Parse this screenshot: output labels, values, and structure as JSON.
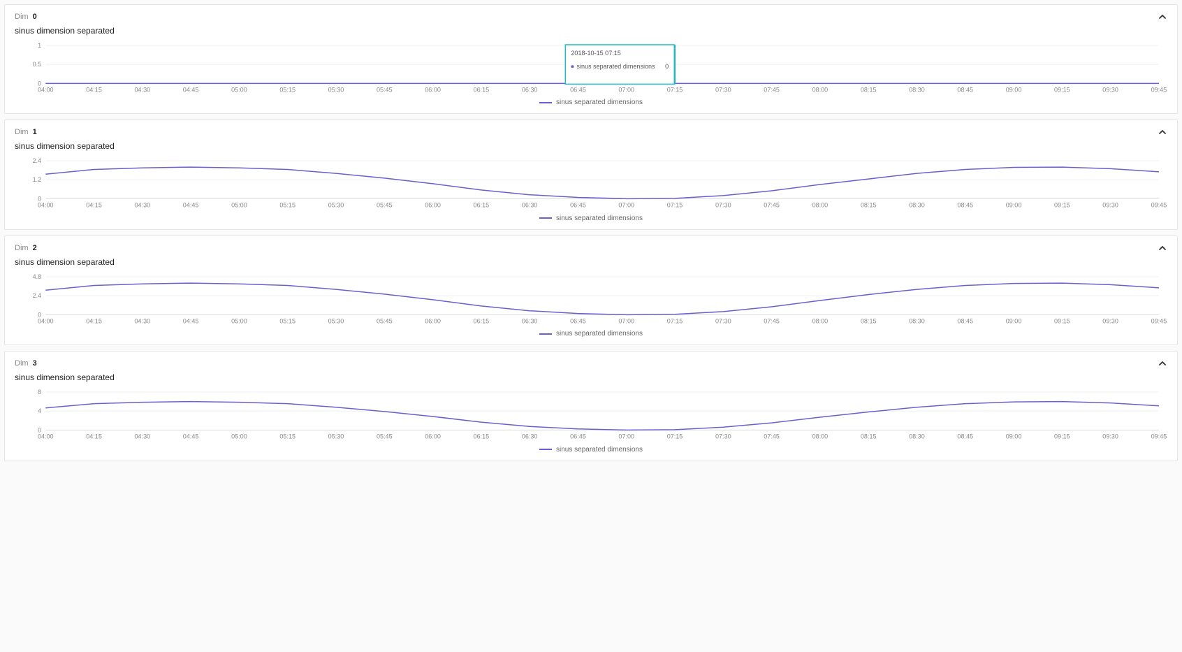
{
  "dim_label_prefix": "Dim",
  "panels": [
    {
      "dim": "0",
      "title": "sinus dimension separated",
      "chart_idx": 0
    },
    {
      "dim": "1",
      "title": "sinus dimension separated",
      "chart_idx": 1
    },
    {
      "dim": "2",
      "title": "sinus dimension separated",
      "chart_idx": 2
    },
    {
      "dim": "3",
      "title": "sinus dimension separated",
      "chart_idx": 3
    }
  ],
  "legend_label": "sinus separated dimensions",
  "x_ticks": [
    "04:00",
    "04:15",
    "04:30",
    "04:45",
    "05:00",
    "05:15",
    "05:30",
    "05:45",
    "06:00",
    "06:15",
    "06:30",
    "06:45",
    "07:00",
    "07:15",
    "07:30",
    "07:45",
    "08:00",
    "08:15",
    "08:30",
    "08:45",
    "09:00",
    "09:15",
    "09:30",
    "09:45"
  ],
  "tooltip": {
    "panel_idx": 0,
    "timestamp_label": "2018-10-15 07:15",
    "series_label": "sinus separated dimensions",
    "value": "0",
    "cursor_x_tick": "07:15",
    "box_x_tick": "06:45"
  },
  "chart_data": [
    {
      "type": "line",
      "title": "sinus dimension separated",
      "xlabel": "",
      "ylabel": "",
      "ylim": [
        0,
        1
      ],
      "y_ticks": [
        0,
        0.5,
        1
      ],
      "x": [
        "04:00",
        "04:15",
        "04:30",
        "04:45",
        "05:00",
        "05:15",
        "05:30",
        "05:45",
        "06:00",
        "06:15",
        "06:30",
        "06:45",
        "07:00",
        "07:15",
        "07:30",
        "07:45",
        "08:00",
        "08:15",
        "08:30",
        "08:45",
        "09:00",
        "09:15",
        "09:30",
        "09:45"
      ],
      "series": [
        {
          "name": "sinus separated dimensions",
          "values": [
            0,
            0,
            0,
            0,
            0,
            0,
            0,
            0,
            0,
            0,
            0,
            0,
            0,
            0,
            0,
            0,
            0,
            0,
            0,
            0,
            0,
            0,
            0,
            0
          ]
        }
      ]
    },
    {
      "type": "line",
      "title": "sinus dimension separated",
      "xlabel": "",
      "ylabel": "",
      "ylim": [
        0,
        2.4
      ],
      "y_ticks": [
        0,
        1.2,
        2.4
      ],
      "x": [
        "04:00",
        "04:15",
        "04:30",
        "04:45",
        "05:00",
        "05:15",
        "05:30",
        "05:45",
        "06:00",
        "06:15",
        "06:30",
        "06:45",
        "07:00",
        "07:15",
        "07:30",
        "07:45",
        "08:00",
        "08:15",
        "08:30",
        "08:45",
        "09:00",
        "09:15",
        "09:30",
        "09:45"
      ],
      "series": [
        {
          "name": "sinus separated dimensions",
          "values": [
            1.55,
            1.85,
            1.95,
            2.0,
            1.95,
            1.85,
            1.6,
            1.3,
            0.95,
            0.55,
            0.25,
            0.08,
            0.0,
            0.02,
            0.2,
            0.5,
            0.9,
            1.25,
            1.6,
            1.85,
            1.98,
            2.0,
            1.9,
            1.7
          ]
        }
      ]
    },
    {
      "type": "line",
      "title": "sinus dimension separated",
      "xlabel": "",
      "ylabel": "",
      "ylim": [
        0,
        4.8
      ],
      "y_ticks": [
        0,
        2.4,
        4.8
      ],
      "x": [
        "04:00",
        "04:15",
        "04:30",
        "04:45",
        "05:00",
        "05:15",
        "05:30",
        "05:45",
        "06:00",
        "06:15",
        "06:30",
        "06:45",
        "07:00",
        "07:15",
        "07:30",
        "07:45",
        "08:00",
        "08:15",
        "08:30",
        "08:45",
        "09:00",
        "09:15",
        "09:30",
        "09:45"
      ],
      "series": [
        {
          "name": "sinus separated dimensions",
          "values": [
            3.1,
            3.7,
            3.9,
            4.0,
            3.9,
            3.7,
            3.2,
            2.6,
            1.9,
            1.1,
            0.5,
            0.15,
            0.0,
            0.05,
            0.4,
            1.0,
            1.8,
            2.55,
            3.2,
            3.7,
            3.95,
            4.0,
            3.8,
            3.4
          ]
        }
      ]
    },
    {
      "type": "line",
      "title": "sinus dimension separated",
      "xlabel": "",
      "ylabel": "",
      "ylim": [
        0,
        8
      ],
      "y_ticks": [
        0,
        4,
        8
      ],
      "x": [
        "04:00",
        "04:15",
        "04:30",
        "04:45",
        "05:00",
        "05:15",
        "05:30",
        "05:45",
        "06:00",
        "06:15",
        "06:30",
        "06:45",
        "07:00",
        "07:15",
        "07:30",
        "07:45",
        "08:00",
        "08:15",
        "08:30",
        "08:45",
        "09:00",
        "09:15",
        "09:30",
        "09:45"
      ],
      "series": [
        {
          "name": "sinus separated dimensions",
          "values": [
            4.65,
            5.55,
            5.85,
            6.0,
            5.85,
            5.55,
            4.8,
            3.9,
            2.85,
            1.65,
            0.75,
            0.23,
            0.0,
            0.08,
            0.6,
            1.5,
            2.7,
            3.8,
            4.8,
            5.55,
            5.93,
            6.0,
            5.7,
            5.1
          ]
        }
      ]
    }
  ]
}
